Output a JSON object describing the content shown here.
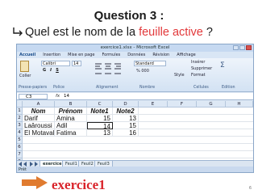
{
  "slide": {
    "title": "Question 3 :",
    "question_prefix": "Quel est le nom de la ",
    "question_highlight": "feuille active",
    "question_suffix": " ?",
    "answer": "exercice1",
    "page_number": "6"
  },
  "excel": {
    "window_title": "exercice1.xlsx - Microsoft Excel",
    "menu_tabs": [
      "Accueil",
      "Insertion",
      "Mise en page",
      "Formules",
      "Données",
      "Révision",
      "Affichage"
    ],
    "ribbon": {
      "paste_label": "Coller",
      "clipboard_group": "Presse-papiers",
      "font_name": "Calibri",
      "font_size": "14",
      "font_group": "Police",
      "alignment_group": "Alignement",
      "number_format": "Standard",
      "number_buttons": "% 000",
      "number_group": "Nombre",
      "style_label": "Style",
      "insert_label": "Insérer",
      "delete_label": "Supprimer",
      "format_label": "Format",
      "cells_group": "Cellules",
      "edition_group": "Edition"
    },
    "name_box": "C3",
    "fx_label": "fx",
    "formula_value": "14",
    "columns": [
      "A",
      "B",
      "C",
      "D",
      "E",
      "F",
      "G",
      "H"
    ],
    "rows": [
      "1",
      "2",
      "3",
      "4",
      "5",
      "6",
      "7",
      "8"
    ],
    "table_headers": [
      "Nom",
      "Prénom",
      "Note1",
      "Note2"
    ],
    "table_rows": [
      [
        "Darif",
        "Amina",
        "15",
        "13"
      ],
      [
        "Laâroussi",
        "Adil",
        "14",
        "15"
      ],
      [
        "El Motavakil",
        "Fatima",
        "13",
        "16"
      ]
    ],
    "sheet_tabs": [
      "exercice1",
      "Feuil1",
      "Feuil2",
      "Feuil3"
    ],
    "status_text": "Prêt"
  }
}
